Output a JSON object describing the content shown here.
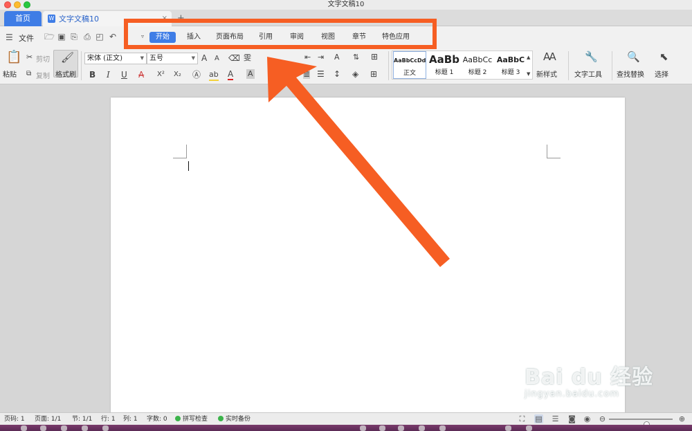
{
  "window": {
    "title": "文字文稿10"
  },
  "tabs": {
    "home": "首页",
    "document": "文字文稿10",
    "doc_icon_letter": "W",
    "close_symbol": "×",
    "add_symbol": "+"
  },
  "menu": {
    "file": "文件",
    "ribbon_tabs": [
      "开始",
      "插入",
      "页面布局",
      "引用",
      "审阅",
      "视图",
      "章节",
      "特色应用"
    ],
    "active_tab": "开始"
  },
  "toolbar": {
    "paste": "粘贴",
    "cut": "剪切",
    "copy": "复制",
    "format_painter": "格式刷",
    "font_name": "宋体 (正文)",
    "font_size": "五号",
    "bold": "B",
    "italic": "I",
    "underline": "U",
    "strike": "A",
    "superscript": "X²",
    "subscript": "X₂",
    "font_color": "A",
    "styles": [
      {
        "sample": "AaBbCcDd",
        "name": "正文"
      },
      {
        "sample": "AaBb",
        "name": "标题 1"
      },
      {
        "sample": "AaBbCc",
        "name": "标题 2"
      },
      {
        "sample": "AaBbC",
        "name": "标题 3"
      }
    ],
    "new_style": "新样式",
    "text_tools": "文字工具",
    "find_replace": "查找替换",
    "select": "选择"
  },
  "statusbar": {
    "page_num": "页码: 1",
    "pages": "页面: 1/1",
    "section": "节: 1/1",
    "row": "行: 1",
    "col": "列: 1",
    "words": "字数: 0",
    "spell_check": "拼写检查",
    "backup": "实时备份",
    "zoom_level": 0.6
  },
  "watermark": {
    "main": "Bai du 经验",
    "sub": "jingyan.baidu.com"
  },
  "colors": {
    "accent": "#3f7de6",
    "annotation": "#f65e23"
  }
}
